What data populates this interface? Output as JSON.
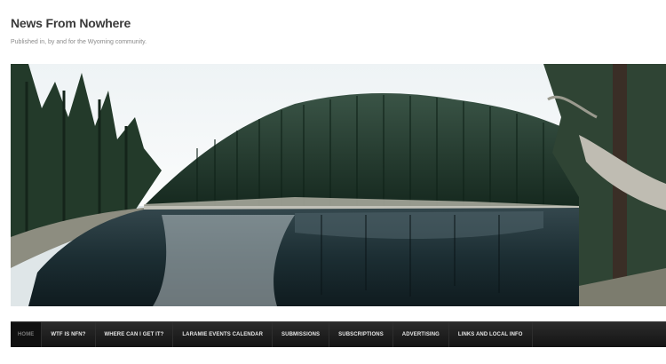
{
  "site": {
    "title": "News From Nowhere",
    "tagline": "Published in, by and for the Wyoming community."
  },
  "banner": {
    "subject": "mountain-lake-panorama",
    "colors": {
      "sky": "#f4f7f8",
      "forest": "#1f3a2c",
      "water": "#16252a",
      "reflection": "#b9c3c6"
    }
  },
  "nav": {
    "items": [
      {
        "label": "Home",
        "active": true
      },
      {
        "label": "WTF is NFN?",
        "active": false
      },
      {
        "label": "Where can I get it?",
        "active": false
      },
      {
        "label": "Laramie Events Calendar",
        "active": false
      },
      {
        "label": "Submissions",
        "active": false
      },
      {
        "label": "Subscriptions",
        "active": false
      },
      {
        "label": "Advertising",
        "active": false
      },
      {
        "label": "Links and Local Info",
        "active": false
      }
    ]
  }
}
